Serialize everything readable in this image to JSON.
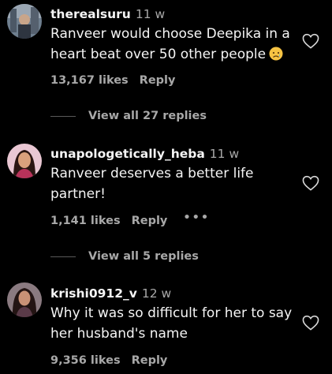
{
  "comments": [
    {
      "username": "therealsuru",
      "time": "11 w",
      "text": "Ranveer would choose Deepika in a heart beat over 50 other people",
      "emoji": "😥",
      "likes": "13,167 likes",
      "reply": "Reply",
      "view_replies": "View all 27 replies"
    },
    {
      "username": "unapologetically_heba",
      "time": "11 w",
      "text": "Ranveer deserves a better life partner!",
      "likes": "1,141 likes",
      "reply": "Reply",
      "more": "•••",
      "view_replies": "View all 5 replies"
    },
    {
      "username": "krishi0912_v",
      "time": "12 w",
      "text": "Why it was so difficult for her to say her husband's name",
      "likes": "9,356 likes",
      "reply": "Reply"
    }
  ],
  "icons": {
    "like": "heart-outline-icon",
    "more": "more-options-icon"
  },
  "colors": {
    "background": "#000000",
    "primary_text": "#f5f5f5",
    "secondary_text": "#a8a8a8"
  }
}
